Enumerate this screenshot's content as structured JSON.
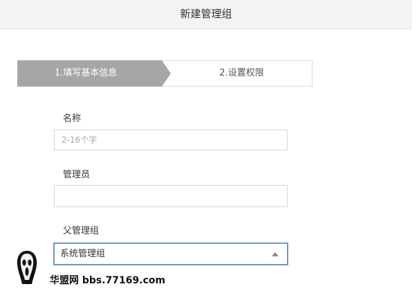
{
  "window": {
    "title": "新建管理组"
  },
  "steps": [
    {
      "label": "1.填写基本信息",
      "active": true
    },
    {
      "label": "2.设置权限",
      "active": false
    }
  ],
  "form": {
    "name_label": "名称",
    "name_placeholder": "2-16个字",
    "admin_label": "管理员",
    "admin_value": "",
    "parent_label": "父管理组",
    "parent_selected": "系统管理组"
  },
  "watermark": {
    "text": "华盟网 bbs.77169.com"
  },
  "colors": {
    "active_step": "#a6a6a6",
    "select_border": "#6f98c7"
  }
}
